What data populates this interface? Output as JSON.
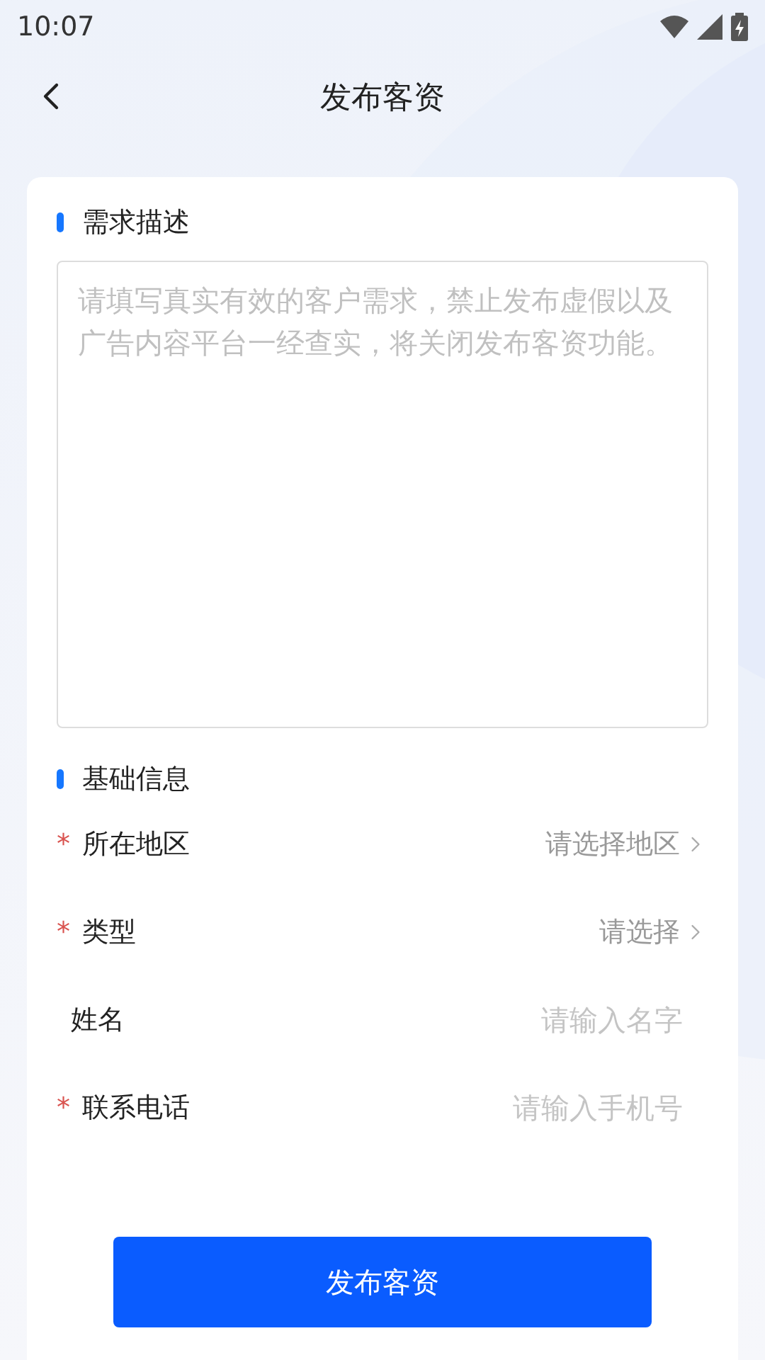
{
  "status_bar": {
    "time": "10:07"
  },
  "header": {
    "title": "发布客资"
  },
  "demand_section": {
    "title": "需求描述",
    "textarea": {
      "placeholder": "请填写真实有效的客户需求，禁止发布虚假以及广告内容平台一经查实，将关闭发布客资功能。"
    }
  },
  "basic_section": {
    "title": "基础信息",
    "required_mark": "*",
    "fields": [
      {
        "label": "所在地区",
        "kind": "select",
        "required": true,
        "placeholder": "请选择地区"
      },
      {
        "label": "类型",
        "kind": "select",
        "required": true,
        "placeholder": "请选择"
      },
      {
        "label": "姓名",
        "kind": "input",
        "required": false,
        "placeholder": "请输入名字"
      },
      {
        "label": "联系电话",
        "kind": "input",
        "required": true,
        "placeholder": "请输入手机号"
      }
    ]
  },
  "submit_button": {
    "label": "发布客资"
  }
}
